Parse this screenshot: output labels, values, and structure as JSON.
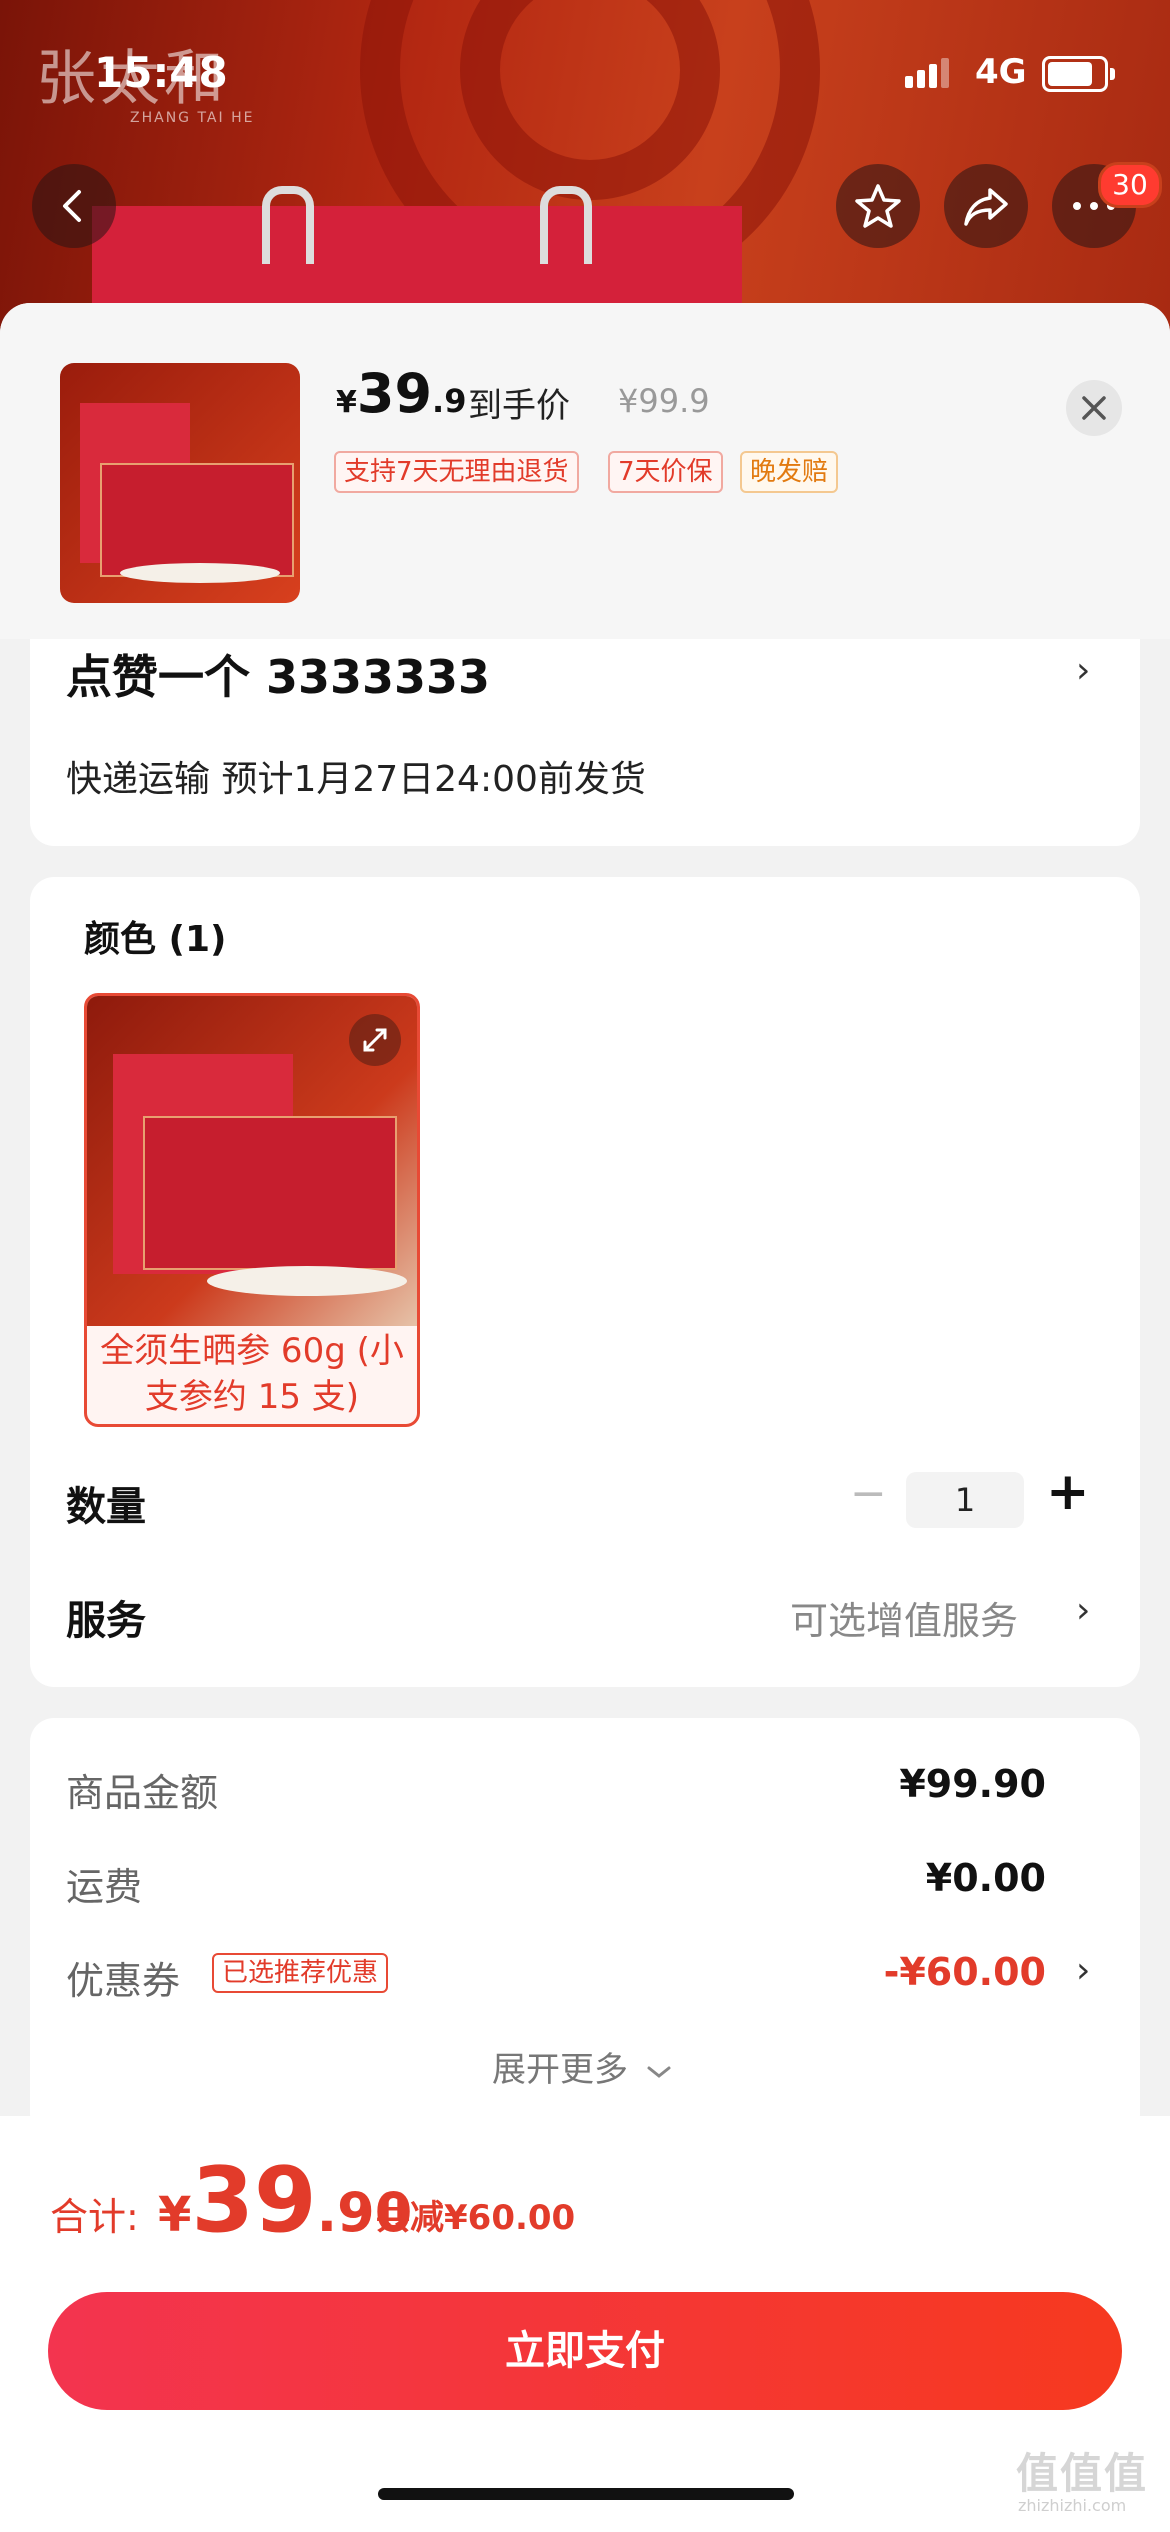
{
  "status_bar": {
    "time": "15:48",
    "network": "4G"
  },
  "hero": {
    "brand": "张太和",
    "brand_sub": "ZHANG TAI HE",
    "cart_badge": "30"
  },
  "summary": {
    "currency": "¥",
    "price_int": "39",
    "price_dec": ".9",
    "price_label": "到手价",
    "original_price": "¥99.9",
    "tags": [
      "支持7天无理由退货",
      "7天价保",
      "晚发赔"
    ]
  },
  "address": {
    "name_line": "点赞一个  3333333",
    "shipping": "快递运输 预计1月27日24:00前发货"
  },
  "spec": {
    "color_title": "颜色 (1)",
    "variant_label": "全须生晒参 60g (小支参约 15 支)"
  },
  "quantity": {
    "label": "数量",
    "value": "1",
    "minus": "−",
    "plus": "+"
  },
  "service": {
    "label": "服务",
    "value": "可选增值服务"
  },
  "fees": {
    "goods_label": "商品金额",
    "goods_value": "¥99.90",
    "shipping_label": "运费",
    "shipping_value": "¥0.00",
    "coupon_label": "优惠券",
    "coupon_tag": "已选推荐优惠",
    "coupon_value": "-¥60.00",
    "more": "展开更多"
  },
  "footer": {
    "total_label": "合计:",
    "total_currency": "¥",
    "total_int": "39",
    "total_dec": ".90",
    "saved": "共减¥60.00",
    "pay_button": "立即支付"
  },
  "watermark": {
    "text": "值值值",
    "sub": "zhizhizhi.com"
  }
}
